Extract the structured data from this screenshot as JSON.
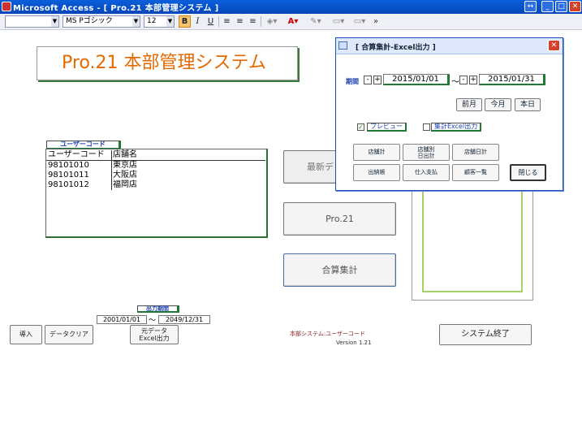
{
  "window": {
    "title": "Microsoft Access - [ Pro.21 本部管理システム ]",
    "controls": {
      "restore": "↔",
      "minimize": "_",
      "maximize": "□",
      "close": "✕"
    }
  },
  "toolbar": {
    "object_value": "",
    "font_name": "MS Pゴシック",
    "font_size": "12",
    "bold": "B",
    "italic": "I",
    "underline": "U"
  },
  "main": {
    "banner_title": "Pro.21  本部管理システム",
    "user_code_label": "ユーザーコード",
    "list": {
      "headers": [
        "ユーザーコード",
        "店舗名"
      ],
      "rows": [
        [
          "98101010",
          "東京店"
        ],
        [
          "98101011",
          "大阪店"
        ],
        [
          "98101012",
          "福岡店"
        ]
      ]
    },
    "btn_latest": "最新デ",
    "btn_pro21": "Pro.21",
    "btn_sum": "合算集計",
    "output_period_label": "出力期間",
    "period_from": "2001/01/01",
    "period_sep": "～",
    "period_to": "2049/12/31",
    "btn_import": "導入",
    "btn_clear": "データクリア",
    "btn_export_l1": "元データ",
    "btn_export_l2": "Excel出力",
    "system_note": "本部システム:ユーザーコード",
    "version": "Version  1.21",
    "btn_exit": "システム終了"
  },
  "dialog": {
    "title": "[  合算集計-Excel出力  ]",
    "close": "✕",
    "period_label": "期間",
    "spin_minus": "-",
    "spin_plus": "+",
    "date_from": "2015/01/01",
    "date_sep": "～",
    "date_to": "2015/01/31",
    "btn_prev_month": "前月",
    "btn_this_month": "今月",
    "btn_today": "本日",
    "preview_checked": true,
    "preview_label": "プレビュー",
    "excel_checked": false,
    "excel_label": "集計Excel出力",
    "buttons": [
      "店舗計",
      "店舗別\n日出計",
      "店舗日計",
      "出納帳",
      "仕入支払",
      "顧客一覧",
      "閉じる"
    ]
  },
  "colors": {
    "titlebar": "#0a5fdb",
    "banner_text": "#e36a00",
    "green_accent": "#1f7a35",
    "label_blue": "#1a3fb0"
  }
}
